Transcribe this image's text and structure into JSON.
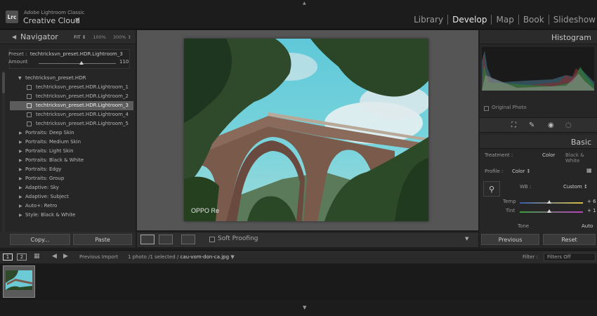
{
  "app": {
    "logo": "Lrc",
    "vendor": "Adobe Lightroom Classic",
    "product": "Creative Cloud"
  },
  "modules": [
    "Library",
    "Develop",
    "Map",
    "Book",
    "Slideshow"
  ],
  "active_module": "Develop",
  "navigator": {
    "title": "Navigator",
    "zoom_options": [
      "FIT ↕",
      "100%",
      "300% ↕"
    ]
  },
  "preset": {
    "label": "Preset :",
    "value": "techtricksvn_preset.HDR.Lightroom_3",
    "amount_label": "Amount",
    "amount_value": "110",
    "amount_fraction": 0.55
  },
  "presets_folder": {
    "name": "techtricksvn_preset.HDR",
    "items": [
      "techtricksvn_preset.HDR.Lightroom_1",
      "techtricksvn_preset.HDR.Lightroom_2",
      "techtricksvn_preset.HDR.Lightroom_3",
      "techtricksvn_preset.HDR.Lightroom_4",
      "techtricksvn_preset.HDR.Lightroom_5"
    ],
    "selected_index": 2
  },
  "preset_groups": [
    "Portraits: Deep Skin",
    "Portraits: Medium Skin",
    "Portraits: Light Skin",
    "Portraits: Black & White",
    "Portraits: Edgy",
    "Portraits: Group",
    "Adaptive: Sky",
    "Adaptive: Subject",
    "Auto+: Retro",
    "Style: Black & White"
  ],
  "left_buttons": {
    "copy": "Copy...",
    "paste": "Paste"
  },
  "photo": {
    "watermark": "OPPO Re"
  },
  "toolbar": {
    "soft_proofing": "Soft Proofing"
  },
  "right": {
    "histogram_title": "Histogram",
    "original_photo": "Original Photo",
    "basic_title": "Basic",
    "treatment_label": "Treatment :",
    "treatment_color": "Color",
    "treatment_bw": "Black & White",
    "profile_label": "Profile :",
    "profile_value": "Color ↕",
    "wb_label": "WB :",
    "wb_value": "Custom ↕",
    "temp_label": "Temp",
    "temp_value": "+ 6",
    "tint_label": "Tint",
    "tint_value": "+ 1",
    "tone_label": "Tone",
    "tone_auto": "Auto",
    "previous": "Previous",
    "reset": "Reset"
  },
  "filmbar": {
    "screen1": "1",
    "screen2": "2",
    "previous_import": "Previous Import",
    "count_text": "1 photo /1 selected /",
    "filename": "cau-vom-don-ca.jpg",
    "filter_label": "Filter :",
    "filter_value": "Filters Off"
  },
  "colors": {
    "accent": "#e8e8e8",
    "panel_bg": "#262626",
    "center_bg": "#555555",
    "selected_row": "#5c5c5c"
  }
}
